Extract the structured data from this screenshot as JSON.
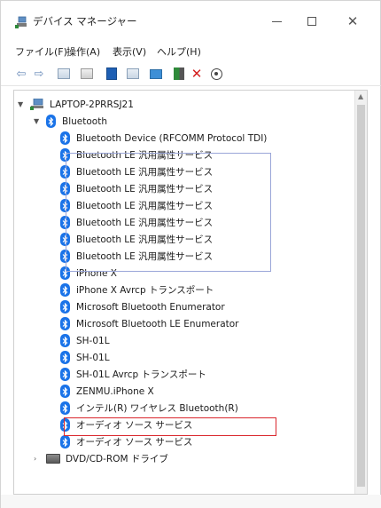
{
  "window": {
    "title": "デバイス マネージャー",
    "icons": {
      "app": "device-manager-icon",
      "minimize": "minimize-icon",
      "maximize": "maximize-icon",
      "close": "close-icon"
    }
  },
  "menu": {
    "items": [
      {
        "label": "ファイル(F)"
      },
      {
        "label": "操作(A)"
      },
      {
        "label": "表示(V)"
      },
      {
        "label": "ヘルプ(H)"
      }
    ]
  },
  "toolbar": {
    "icons": [
      "back-arrow-icon",
      "forward-arrow-icon",
      "properties-icon",
      "view-icon",
      "driver-update-icon",
      "device-list-icon",
      "monitor-icon",
      "enable-device-icon",
      "uninstall-x-icon",
      "scan-hardware-icon"
    ]
  },
  "tree": {
    "computer": {
      "label": "LAPTOP-2PRRSJ21",
      "expanded": true
    },
    "category": {
      "label": "Bluetooth",
      "expanded": true
    },
    "devices": [
      {
        "label": "Bluetooth Device (RFCOMM Protocol TDI)"
      },
      {
        "label": "Bluetooth LE 汎用属性サービス"
      },
      {
        "label": "Bluetooth LE 汎用属性サービス"
      },
      {
        "label": "Bluetooth LE 汎用属性サービス"
      },
      {
        "label": "Bluetooth LE 汎用属性サービス"
      },
      {
        "label": "Bluetooth LE 汎用属性サービス"
      },
      {
        "label": "Bluetooth LE 汎用属性サービス"
      },
      {
        "label": "Bluetooth LE 汎用属性サービス"
      },
      {
        "label": "iPhone X"
      },
      {
        "label": "iPhone X Avrcp トランスポート"
      },
      {
        "label": "Microsoft Bluetooth Enumerator"
      },
      {
        "label": "Microsoft Bluetooth LE Enumerator"
      },
      {
        "label": "SH-01L"
      },
      {
        "label": "SH-01L"
      },
      {
        "label": "SH-01L Avrcp トランスポート"
      },
      {
        "label": "ZENMU.iPhone X"
      },
      {
        "label": "インテル(R) ワイヤレス Bluetooth(R)"
      },
      {
        "label": "オーディオ ソース サービス"
      },
      {
        "label": "オーディオ ソース サービス"
      }
    ],
    "next_category": {
      "label": "DVD/CD-ROM ドライブ",
      "expanded": false
    },
    "highlight_colors": {
      "group_box": "#9aa6d8",
      "selected_box": "#d9262c"
    },
    "bluetooth_color": "#1a73e8"
  }
}
